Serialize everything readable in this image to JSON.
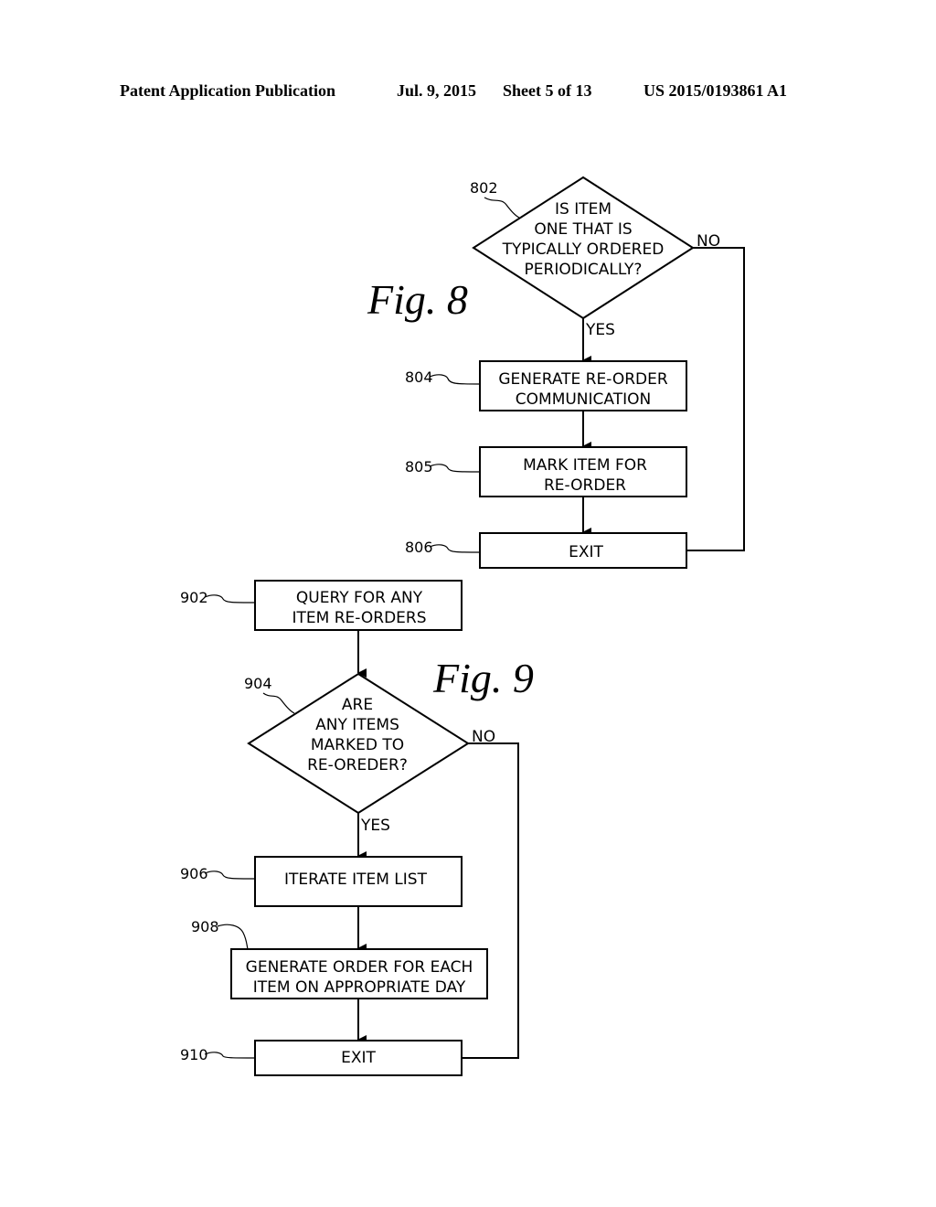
{
  "header": {
    "publication": "Patent Application Publication",
    "date": "Jul. 9, 2015",
    "sheet": "Sheet 5 of 13",
    "number": "US 2015/0193861 A1"
  },
  "fig8": {
    "title": "Fig. 8",
    "decision_802": {
      "ref": "802",
      "lines": [
        "IS ITEM",
        "ONE THAT IS",
        "TYPICALLY ORDERED",
        "PERIODICALLY?"
      ],
      "yes_label": "YES",
      "no_label": "NO"
    },
    "step_804": {
      "ref": "804",
      "lines": [
        "GENERATE RE-ORDER",
        "COMMUNICATION"
      ]
    },
    "step_805": {
      "ref": "805",
      "lines": [
        "MARK ITEM FOR",
        "RE-ORDER"
      ]
    },
    "step_806": {
      "ref": "806",
      "lines": [
        "EXIT"
      ]
    }
  },
  "fig9": {
    "title": "Fig. 9",
    "step_902": {
      "ref": "902",
      "lines": [
        "QUERY FOR ANY",
        "ITEM RE-ORDERS"
      ]
    },
    "decision_904": {
      "ref": "904",
      "lines": [
        "ARE",
        "ANY ITEMS",
        "MARKED TO",
        "RE-OREDER?"
      ],
      "yes_label": "YES",
      "no_label": "NO"
    },
    "step_906": {
      "ref": "906",
      "lines": [
        "ITERATE ITEM LIST"
      ]
    },
    "step_908": {
      "ref": "908",
      "lines": [
        "GENERATE ORDER FOR EACH",
        "ITEM ON APPROPRIATE DAY"
      ]
    },
    "step_910": {
      "ref": "910",
      "lines": [
        "EXIT"
      ]
    }
  }
}
